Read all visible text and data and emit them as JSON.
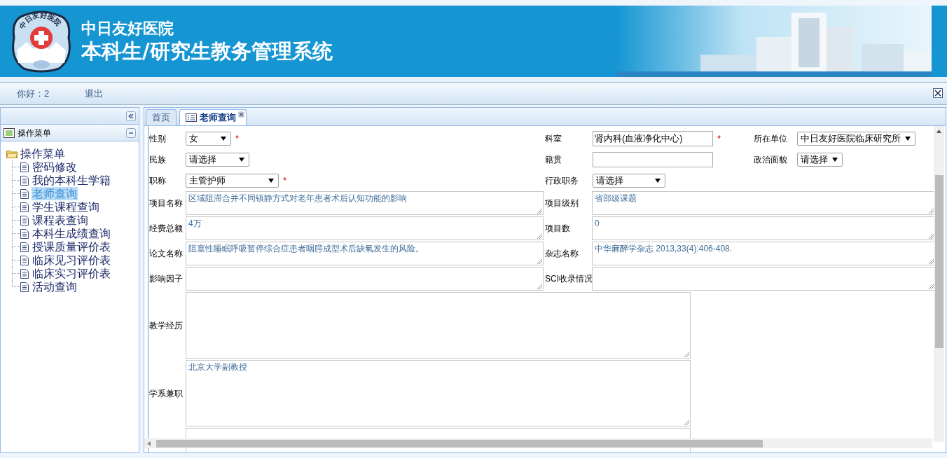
{
  "header": {
    "logo_text": "中日友好医院",
    "hospital": "中日友好医院",
    "system": "本科生/研究生教务管理系统"
  },
  "toolbar": {
    "greeting": "你好：2",
    "logout": "退出"
  },
  "sidebar": {
    "title": "操作菜单",
    "tree": {
      "label": "操作菜单",
      "expanded": true,
      "children": [
        {
          "label": "密码修改",
          "selected": false
        },
        {
          "label": "我的本科生学籍",
          "selected": false
        },
        {
          "label": "老师查询",
          "selected": true
        },
        {
          "label": "学生课程查询",
          "selected": false
        },
        {
          "label": "课程表查询",
          "selected": false
        },
        {
          "label": "本科生成绩查询",
          "selected": false
        },
        {
          "label": "授课质量评价表",
          "selected": false
        },
        {
          "label": "临床见习评价表",
          "selected": false
        },
        {
          "label": "临床实习评价表",
          "selected": false
        },
        {
          "label": "活动查询",
          "selected": false
        }
      ]
    }
  },
  "tabs": [
    {
      "label": "首页",
      "selected": false,
      "closable": false
    },
    {
      "label": "老师查询",
      "selected": true,
      "closable": true
    }
  ],
  "form": {
    "required_mark": "*",
    "top_rows": [
      [
        {
          "label": "性别",
          "kind": "select",
          "value": "女",
          "required": true
        },
        {
          "label": "科室",
          "kind": "input",
          "value": "肾内科(血液净化中心)",
          "required": true
        },
        {
          "label": "所在单位",
          "kind": "select",
          "value": "中日友好医院临床研究所",
          "required": false
        }
      ],
      [
        {
          "label": "民族",
          "kind": "select",
          "value": "请选择",
          "required": false
        },
        {
          "label": "籍贯",
          "kind": "input",
          "required": false
        },
        {
          "label": "政治面貌",
          "kind": "select",
          "value": "请选择",
          "required": false
        }
      ],
      [
        {
          "label": "职称",
          "kind": "select",
          "value": "主管护师",
          "required": true
        },
        {
          "label": "行政职务",
          "kind": "select",
          "value": "请选择",
          "required": false
        }
      ]
    ],
    "pair_rows": [
      [
        {
          "label": "项目名称",
          "value": "区域阻滞合并不同镇静方式对老年患者术后认知功能的影响"
        },
        {
          "label": "项目级别",
          "value": "省部级课题"
        }
      ],
      [
        {
          "label": "经费总额",
          "value": "4万"
        },
        {
          "label": "项目数",
          "value": "0"
        }
      ],
      [
        {
          "label": "论文名称",
          "value": "阻塞性睡眠呼吸暂停综合症患者咽腭成型术后缺氧发生的风险。"
        },
        {
          "label": "杂志名称",
          "value": "中华麻醉学杂志 2013,33(4):406-408."
        }
      ],
      [
        {
          "label": "影响因子"
        },
        {
          "label": "SCI收录情况"
        }
      ]
    ],
    "wide_rows": [
      {
        "label": "教学经历"
      },
      {
        "label": "学系兼职",
        "value": "北京大学副教授"
      },
      {}
    ]
  }
}
